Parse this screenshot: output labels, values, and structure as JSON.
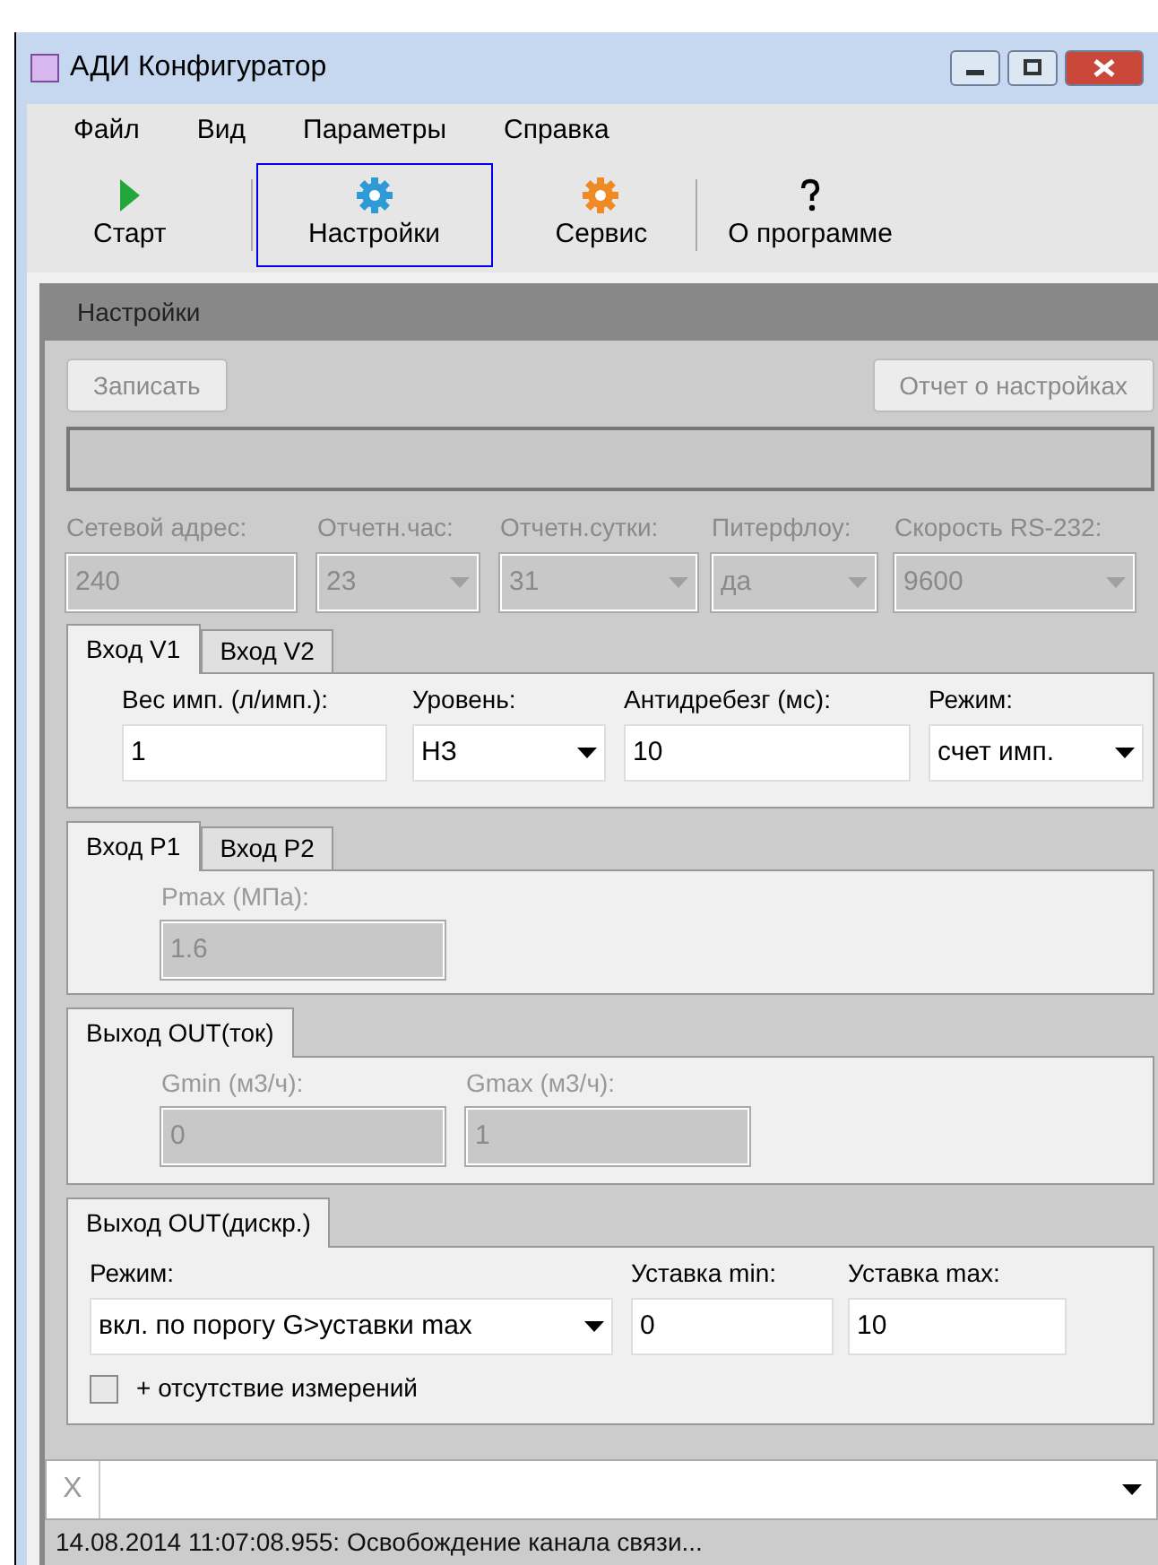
{
  "window": {
    "title": "АДИ Конфигуратор"
  },
  "menu": [
    "Файл",
    "Вид",
    "Параметры",
    "Справка"
  ],
  "toolbar": [
    {
      "label": "Старт",
      "kind": "play",
      "selected": false
    },
    {
      "label": "Настройки",
      "kind": "gear",
      "selected": true
    },
    {
      "label": "Сервис",
      "kind": "service",
      "selected": false
    },
    {
      "label": "О программе",
      "kind": "help",
      "selected": false
    }
  ],
  "panel": {
    "title": "Настройки",
    "buttons": [
      {
        "label": "Записать",
        "disabled": true
      },
      {
        "label": "Отчет о настройках",
        "disabled": true
      }
    ],
    "params": [
      {
        "label": "Сетевой адрес:",
        "value": "240",
        "kind": "text",
        "disabled": true
      },
      {
        "label": "Отчетн.час:",
        "value": "23",
        "kind": "combo",
        "disabled": true
      },
      {
        "label": "Отчетн.сутки:",
        "value": "31",
        "kind": "combo",
        "disabled": true
      },
      {
        "label": "Питерфлоу:",
        "value": "да",
        "kind": "combo",
        "disabled": true
      },
      {
        "label": "Скорость RS-232:",
        "value": "9600",
        "kind": "combo",
        "disabled": true
      }
    ],
    "groups": [
      {
        "tabs": [
          {
            "label": "Вход V1",
            "selected": true
          },
          {
            "label": "Вход V2",
            "selected": false
          }
        ],
        "fields": [
          {
            "label": "Вес имп. (л/имп.):",
            "value": "1",
            "kind": "text",
            "disabled": false
          },
          {
            "label": "Уровень:",
            "value": "НЗ",
            "kind": "combo",
            "disabled": false
          },
          {
            "label": "Антидребезг (мс):",
            "value": "10",
            "kind": "text",
            "disabled": false
          },
          {
            "label": "Режим:",
            "value": "счет имп.",
            "kind": "combo",
            "disabled": false
          }
        ]
      },
      {
        "tabs": [
          {
            "label": "Вход P1",
            "selected": true
          },
          {
            "label": "Вход P2",
            "selected": false
          }
        ],
        "fields": [
          {
            "label": "Pmax (МПа):",
            "value": "1.6",
            "kind": "text",
            "disabled": true
          }
        ]
      },
      {
        "tabs": [
          {
            "label": "Выход OUT(ток)",
            "selected": true
          }
        ],
        "fields": [
          {
            "label": "Gmin (м3/ч):",
            "value": "0",
            "kind": "text",
            "disabled": true
          },
          {
            "label": "Gmax (м3/ч):",
            "value": "1",
            "kind": "text",
            "disabled": true
          }
        ]
      },
      {
        "tabs": [
          {
            "label": "Выход OUT(дискр.)",
            "selected": true
          }
        ],
        "fields": [
          {
            "label": "Режим:",
            "value": "вкл. по порогу G>уставки max",
            "kind": "combo",
            "disabled": false
          },
          {
            "label": "Уставка min:",
            "value": "0",
            "kind": "text",
            "disabled": false
          },
          {
            "label": "Уставка max:",
            "value": "10",
            "kind": "text",
            "disabled": false
          }
        ],
        "checkbox": {
          "label": "+ отсутствие измерений",
          "checked": false
        }
      }
    ]
  },
  "command": {
    "clear": "X"
  },
  "status_bar": "14.08.2014 11:07:08.955: Освобождение канала связи..."
}
